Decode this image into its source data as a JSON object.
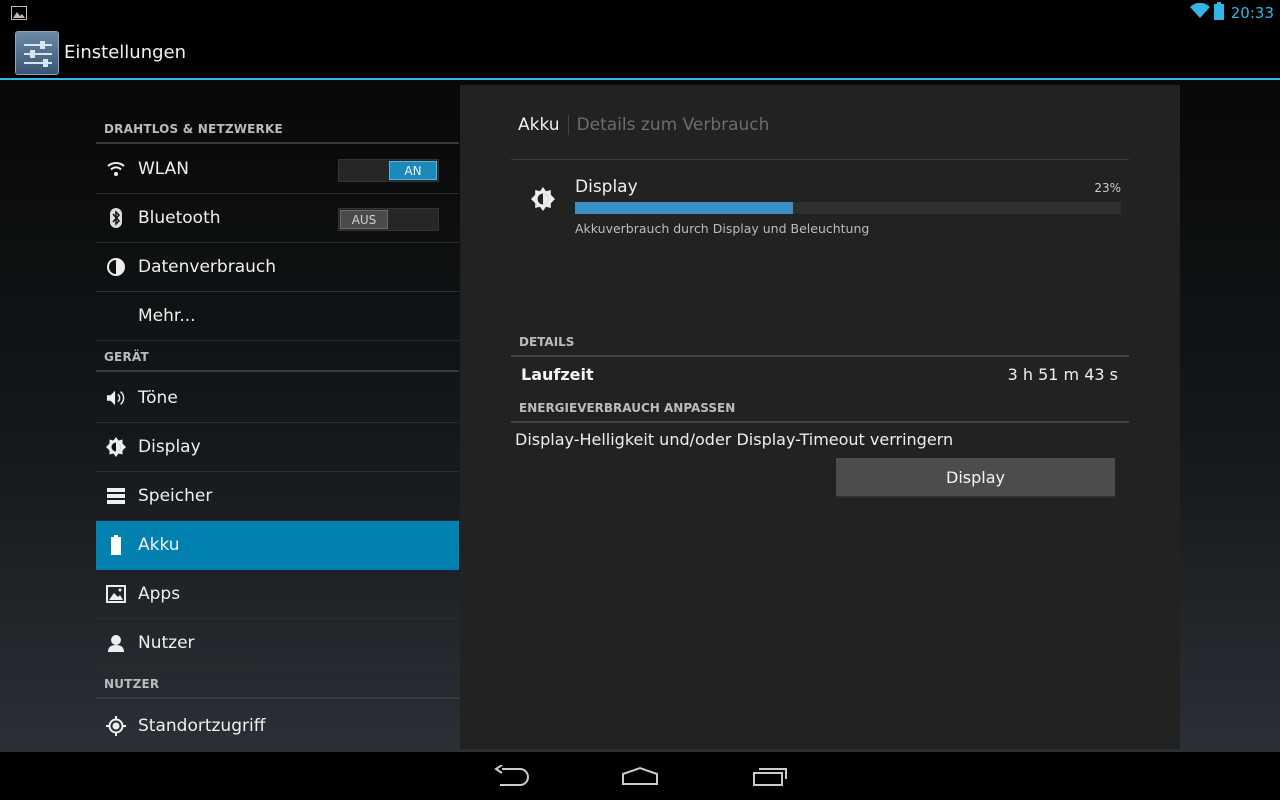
{
  "status_bar": {
    "time": "20:33"
  },
  "action_bar": {
    "title": "Einstellungen"
  },
  "sidebar": {
    "sections": [
      {
        "title": "DRAHTLOS & NETZWERKE"
      },
      {
        "title": "GERÄT"
      },
      {
        "title": "NUTZER"
      }
    ],
    "items": [
      {
        "label": "WLAN",
        "icon": "wifi-icon",
        "toggle": "AN"
      },
      {
        "label": "Bluetooth",
        "icon": "bluetooth-icon",
        "toggle": "AUS"
      },
      {
        "label": "Datenverbrauch",
        "icon": "data-usage-icon"
      },
      {
        "label": "Mehr..."
      },
      {
        "label": "Töne",
        "icon": "volume-icon"
      },
      {
        "label": "Display",
        "icon": "brightness-icon"
      },
      {
        "label": "Speicher",
        "icon": "storage-icon"
      },
      {
        "label": "Akku",
        "icon": "battery-icon",
        "selected": true
      },
      {
        "label": "Apps",
        "icon": "apps-icon"
      },
      {
        "label": "Nutzer",
        "icon": "user-icon"
      },
      {
        "label": "Standortzugriff",
        "icon": "location-icon"
      }
    ]
  },
  "detail": {
    "breadcrumb": {
      "parent": "Akku",
      "current": "Details zum Verbrauch"
    },
    "usage": {
      "title": "Display",
      "percent_label": "23%",
      "percent": 0.4,
      "subtitle": "Akkuverbrauch durch Display und Beleuchtung"
    },
    "details_header": "DETAILS",
    "runtime": {
      "label": "Laufzeit",
      "value": "3 h 51 m 43 s"
    },
    "adjust_header": "ENERGIEVERBRAUCH ANPASSEN",
    "tip": "Display-Helligkeit und/oder Display-Timeout verringern",
    "button_label": "Display"
  },
  "colors": {
    "accent": "#33b5e5",
    "selected": "#0280b0",
    "bar": "#3a8fc4"
  }
}
